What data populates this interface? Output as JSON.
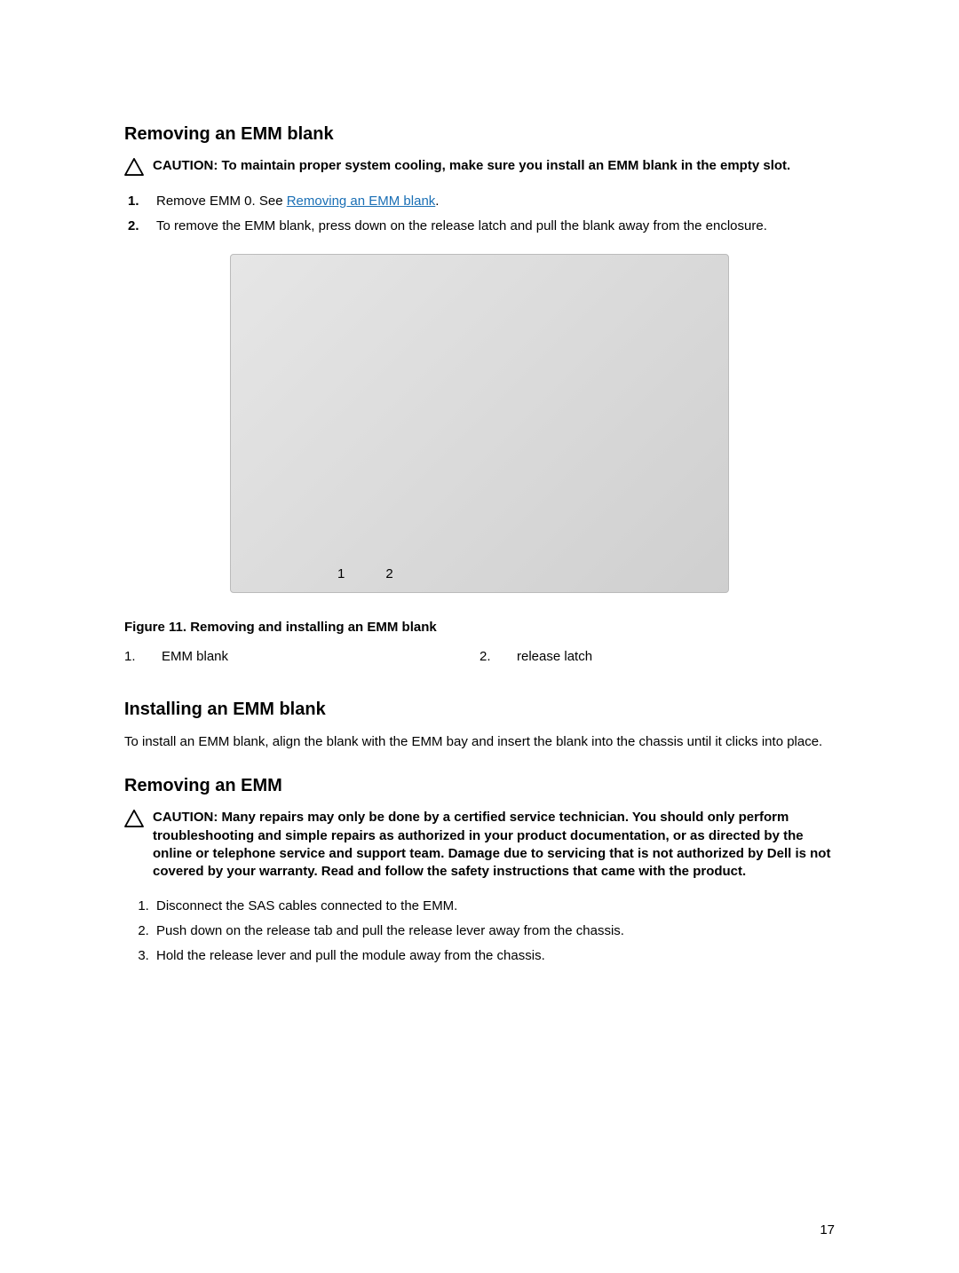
{
  "section1": {
    "heading": "Removing an EMM blank",
    "caution_prefix": "CAUTION: ",
    "caution_body": "To maintain proper system cooling, make sure you install an EMM blank in the empty slot.",
    "step1_pre": "Remove EMM 0. See ",
    "step1_link": "Removing an EMM blank",
    "step1_post": ".",
    "step2": "To remove the EMM blank, press down on the release latch and pull the blank away from the enclosure."
  },
  "figure": {
    "callout1": "1",
    "callout2": "2",
    "caption": "Figure 11. Removing and installing an EMM blank",
    "legend1_num": "1.",
    "legend1_text": "EMM blank",
    "legend2_num": "2.",
    "legend2_text": "release latch"
  },
  "section2": {
    "heading": "Installing an EMM blank",
    "body": "To install an EMM blank, align the blank with the EMM bay and insert the blank into the chassis until it clicks into place."
  },
  "section3": {
    "heading": "Removing an EMM",
    "caution_prefix": "CAUTION: ",
    "caution_body": "Many repairs may only be done by a certified service technician. You should only perform troubleshooting and simple repairs as authorized in your product documentation, or as directed by the online or telephone service and support team. Damage due to servicing that is not authorized by Dell is not covered by your warranty. Read and follow the safety instructions that came with the product.",
    "step1": "Disconnect the SAS cables connected to the EMM.",
    "step2": "Push down on the release tab and pull the release lever away from the chassis.",
    "step3": "Hold the release lever and pull the module away from the chassis."
  },
  "page_number": "17"
}
